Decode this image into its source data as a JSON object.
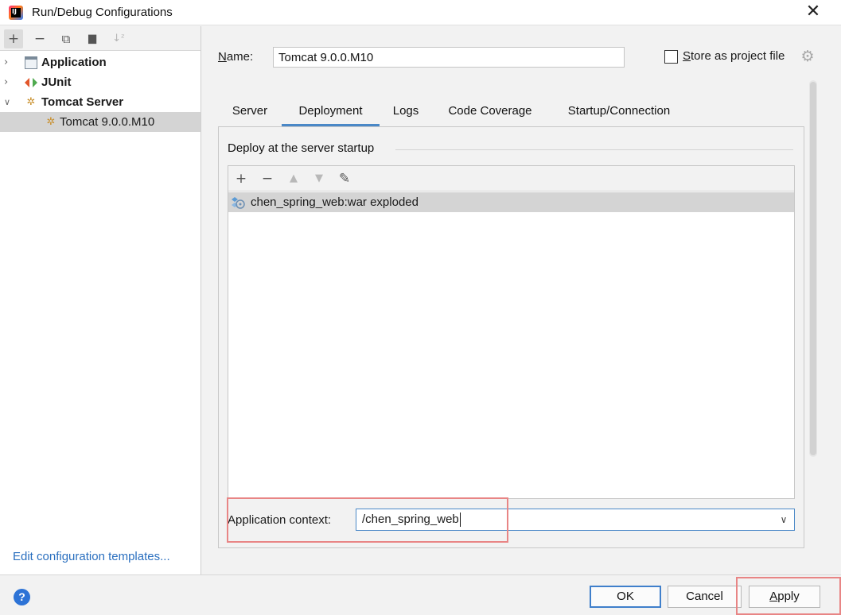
{
  "window": {
    "title": "Run/Debug Configurations",
    "close_glyph": "✕"
  },
  "left_toolbar": {
    "add": "+",
    "remove": "−",
    "copy": "⧉",
    "folder": "▆",
    "sort": "↓ᶻ"
  },
  "tree": {
    "items": [
      {
        "label": "Application",
        "icon": "application-icon",
        "expanded": false
      },
      {
        "label": "JUnit",
        "icon": "junit-icon",
        "expanded": false
      },
      {
        "label": "Tomcat Server",
        "icon": "tomcat-icon",
        "expanded": true
      },
      {
        "label": "Tomcat 9.0.0.M10",
        "icon": "tomcat-icon",
        "selected": true
      }
    ],
    "edit_templates": "Edit configuration templates..."
  },
  "config": {
    "name_label_mnemonic": "N",
    "name_label_rest": "ame:",
    "name_value": "Tomcat 9.0.0.M10",
    "store_label_mnemonic": "S",
    "store_label_rest": "tore as project file",
    "store_checked": false
  },
  "tabs": [
    {
      "label": "Server",
      "active": false
    },
    {
      "label": "Deployment",
      "active": true
    },
    {
      "label": "Logs",
      "active": false
    },
    {
      "label": "Code Coverage",
      "active": false
    },
    {
      "label": "Startup/Connection",
      "active": false
    }
  ],
  "deployment": {
    "section_title": "Deploy at the server startup",
    "toolbar": {
      "add": "+",
      "remove": "−",
      "up": "▲",
      "down": "▼",
      "edit": "✎"
    },
    "artifacts": [
      "chen_spring_web:war exploded"
    ],
    "context_label": "Application context:",
    "context_value": "/chen_spring_web",
    "dropdown_glyph": "∨"
  },
  "buttons": {
    "help": "?",
    "ok": "OK",
    "cancel": "Cancel",
    "apply_mnemonic": "A",
    "apply_rest": "pply"
  },
  "colors": {
    "accent": "#4a88c7",
    "highlight_box": "#e88585",
    "link": "#2a6fbf",
    "selection": "#d4d4d4"
  }
}
